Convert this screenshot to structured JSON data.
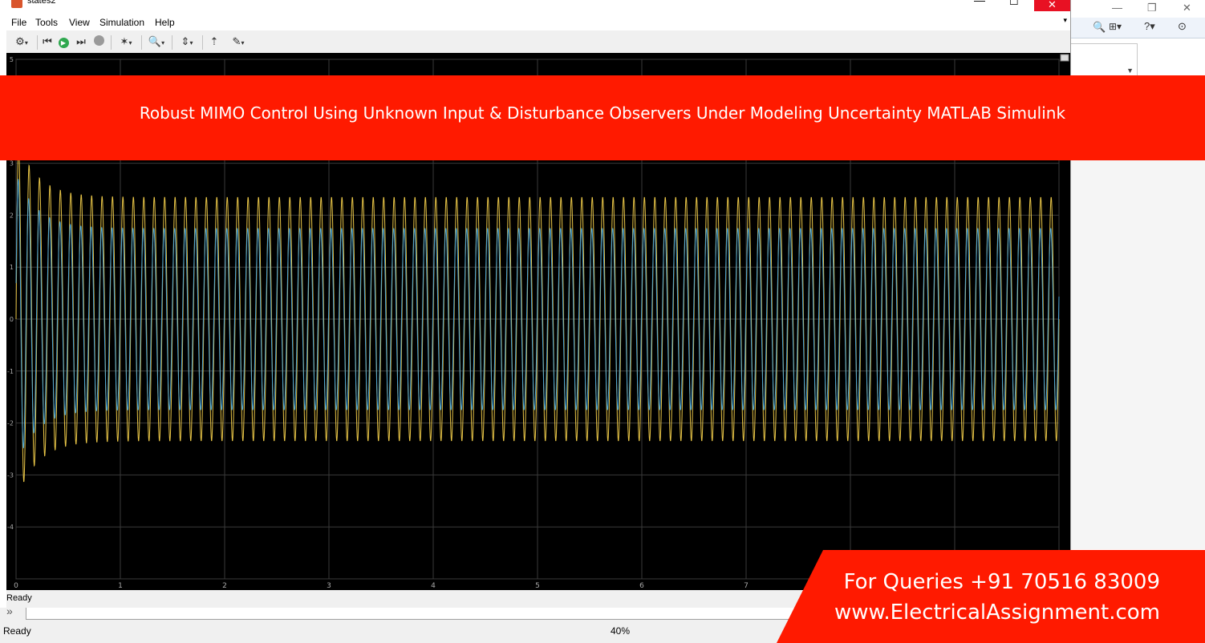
{
  "window": {
    "title": "states2",
    "controls": {
      "minimize": "—",
      "maximize": "☐",
      "close": "✕"
    }
  },
  "menu": [
    "File",
    "Tools",
    "View",
    "Simulation",
    "Help"
  ],
  "toolbar": {
    "icons": [
      "settings-icon",
      "step-back-icon",
      "run-icon",
      "step-forward-icon",
      "stop-icon",
      "highlight-icon",
      "zoom-icon",
      "autoscale-icon",
      "pin-icon",
      "style-icon"
    ]
  },
  "scope_status": "Ready",
  "background_window": {
    "status": "Ready",
    "zoom": "40%"
  },
  "banner": {
    "title": "Robust MIMO Control Using Unknown Input & Disturbance Observers Under Modeling Uncertainty  MATLAB Simulink",
    "query_line1": "For Queries +91 70516 83009",
    "query_line2": "www.ElectricalAssignment.com"
  },
  "chart_data": {
    "type": "line",
    "xlim": [
      0,
      10
    ],
    "ylim": [
      -5,
      5
    ],
    "x_ticks": [
      "0",
      "1",
      "2",
      "3",
      "4",
      "5",
      "6",
      "7"
    ],
    "y_ticks": [
      "5",
      "3",
      "2",
      "1",
      "0",
      "-1",
      "-2",
      "-3",
      "-4"
    ],
    "grid": true,
    "series": [
      {
        "color": "#e8c547",
        "steady_amplitude": 2.35,
        "peak": 3.5,
        "frequency": 10
      },
      {
        "color": "#4da6d6",
        "steady_amplitude": 1.75,
        "peak": 2.8,
        "frequency": 10
      }
    ]
  }
}
